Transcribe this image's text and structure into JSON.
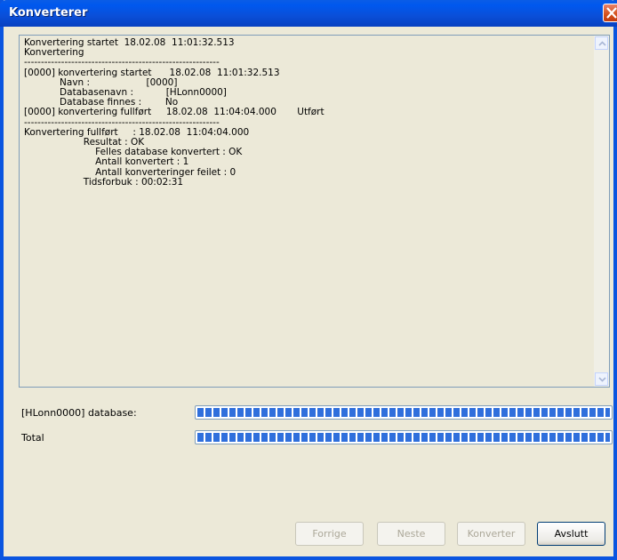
{
  "window": {
    "title": "Konverterer"
  },
  "log": {
    "text": "Konvertering startet  18.02.08  11:01:32.513\nKonvertering\n----------------------------------------------------------\n[0000] konvertering startet      18.02.08  11:01:32.513\n            Navn :                   [0000]\n            Databasenavn :           [HLonn0000]\n            Database finnes :        No\n[0000] konvertering fullført     18.02.08  11:04:04.000       Utført\n----------------------------------------------------------\nKonvertering fullført     : 18.02.08  11:04:04.000\n                    Resultat : OK\n                        Felles database konvertert : OK\n                        Antall konvertert : 1\n                        Antall konverteringer feilet : 0\n                    Tidsforbuk : 00:02:31"
  },
  "progress": [
    {
      "label": "[HLonn0000] database:",
      "percent": 100
    },
    {
      "label": "Total",
      "percent": 100
    }
  ],
  "buttons": {
    "back": "Forrige",
    "next": "Neste",
    "convert": "Konverter",
    "exit": "Avslutt"
  },
  "icons": {
    "close": "close-icon",
    "scroll_up": "chevron-up-icon",
    "scroll_down": "chevron-down-icon"
  }
}
